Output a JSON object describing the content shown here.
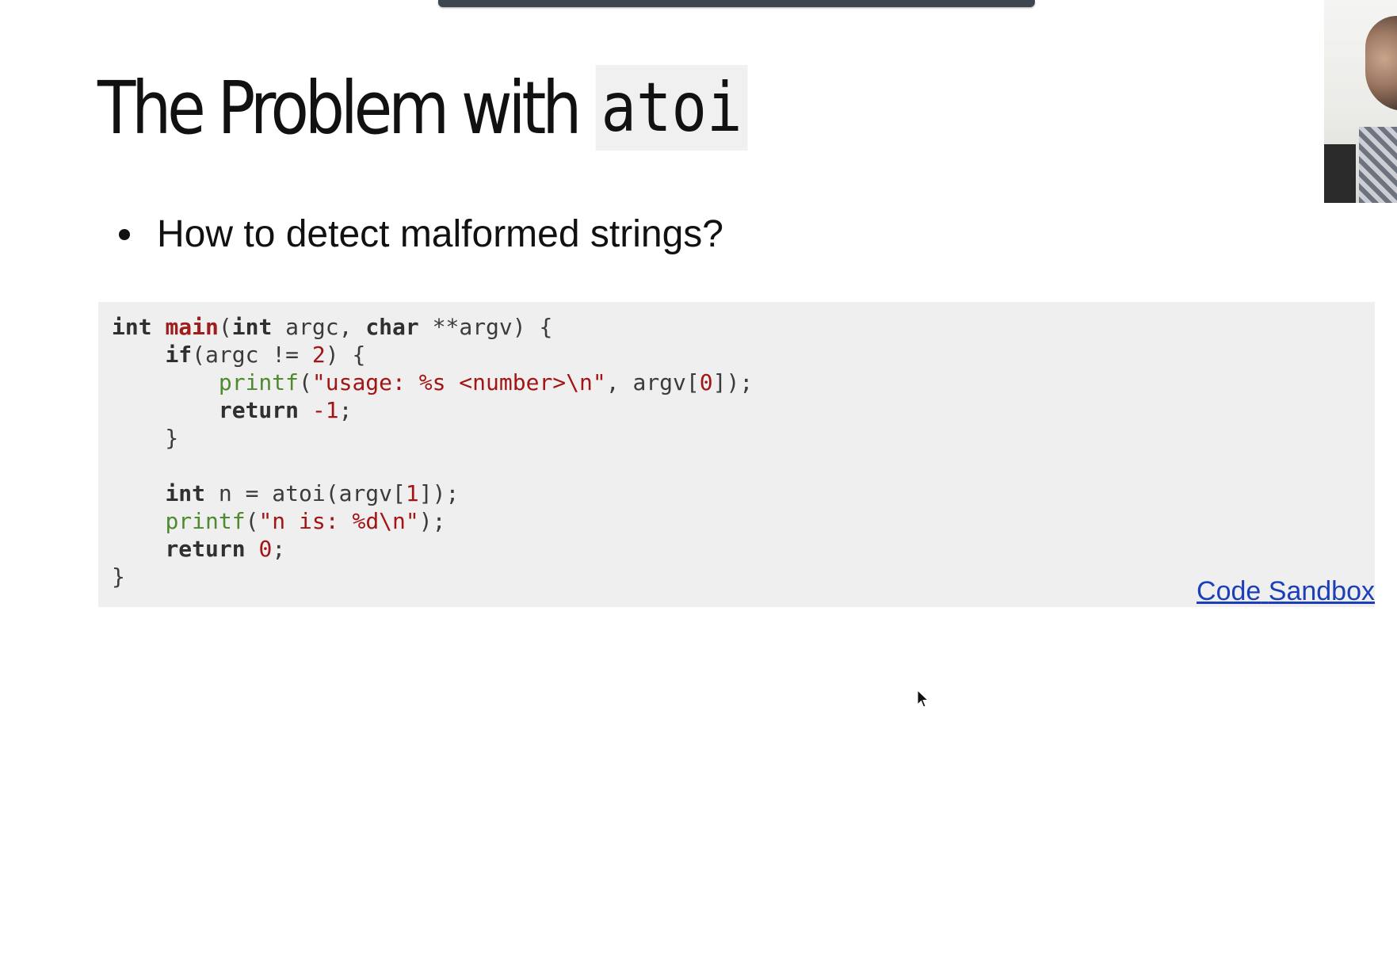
{
  "slide": {
    "title_text": "The Problem with",
    "title_code": "atoi",
    "bullets": [
      "How to detect malformed strings?"
    ]
  },
  "code": {
    "lines": [
      "int main(int argc, char **argv) {",
      "    if(argc != 2) {",
      "        printf(\"usage: %s <number>\\n\", argv[0]);",
      "        return -1;",
      "    }",
      "",
      "    int n = atoi(argv[1]);",
      "    printf(\"n is: %d\\n\");",
      "    return 0;",
      "}"
    ]
  },
  "links": {
    "code_label": "Code",
    "sandbox_label": "Sandbox",
    "color": "#1a3fb8"
  },
  "colors": {
    "background": "#ffffff",
    "code_background": "#efefef",
    "keyword": "#303030",
    "function_name": "#a11c1c",
    "string_literal": "#a31515",
    "builtin_call": "#4e8a2f"
  },
  "icons": {
    "cursor": "mouse-pointer-icon"
  }
}
